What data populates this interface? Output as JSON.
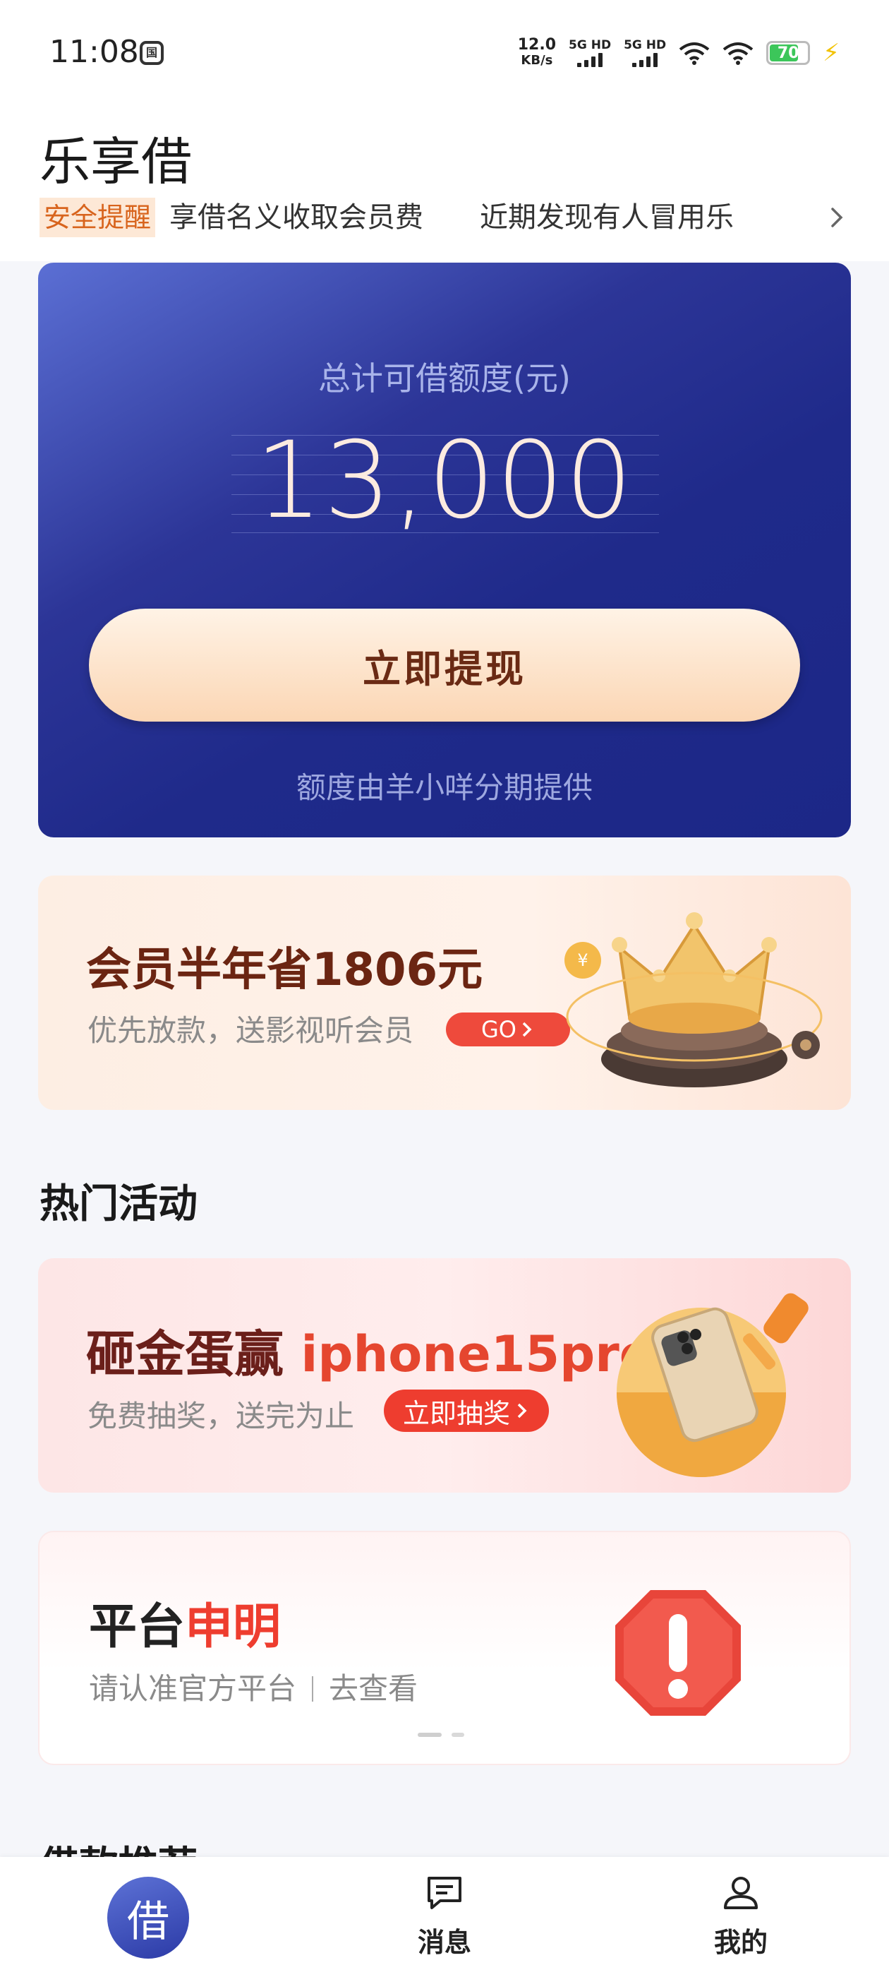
{
  "status_bar": {
    "time": "11:08",
    "net_speed_value": "12.0",
    "net_speed_unit": "KB/s",
    "sim1_label": "5G HD",
    "sim2_label": "5G HD",
    "battery": "70"
  },
  "header": {
    "title": "乐享借",
    "notice_tag": "安全提醒",
    "notice_text_1": "享借名义收取会员费",
    "notice_text_2": "近期发现有人冒用乐"
  },
  "credit_card": {
    "label": "总计可借额度(元)",
    "amount": "13,000",
    "button": "立即提现",
    "provider": "额度由羊小咩分期提供"
  },
  "member_banner": {
    "title": "会员半年省1806元",
    "subtitle": "优先放款，送影视听会员",
    "go": "GO"
  },
  "hot_section": {
    "title": "热门活动"
  },
  "egg_banner": {
    "title_part1": "砸金蛋赢",
    "title_part2": "iphone15pro",
    "subtitle": "免费抽奖，送完为止",
    "button": "立即抽奖"
  },
  "statement_banner": {
    "title_part1": "平台",
    "title_part2": "申明",
    "subtitle_part1": "请认准官方平台",
    "subtitle_part2": "去查看"
  },
  "recommend_section": {
    "title": "借款推荐"
  },
  "bottom_nav": {
    "borrow": "借",
    "messages": "消息",
    "mine": "我的"
  },
  "colors": {
    "card_primary": "#1f2a8a",
    "accent_red": "#ee3d2f",
    "button_peach": "#fbd6b4"
  }
}
